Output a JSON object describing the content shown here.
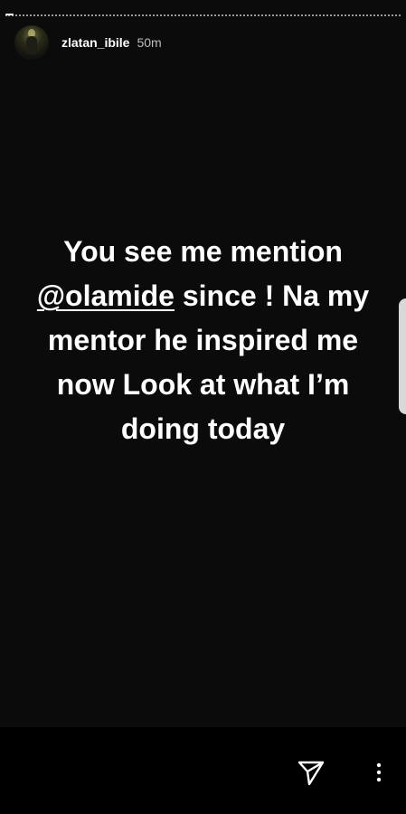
{
  "story": {
    "username": "zlatan_ibile",
    "time_ago": "50m",
    "text_parts": [
      "You see me mention ",
      "@olamide",
      "  since  ! Na my mentor he inspired me now Look at what I’m doing today"
    ],
    "progress": 0.02
  },
  "icons": {
    "send": "send-icon",
    "more": "more-vertical-icon"
  }
}
